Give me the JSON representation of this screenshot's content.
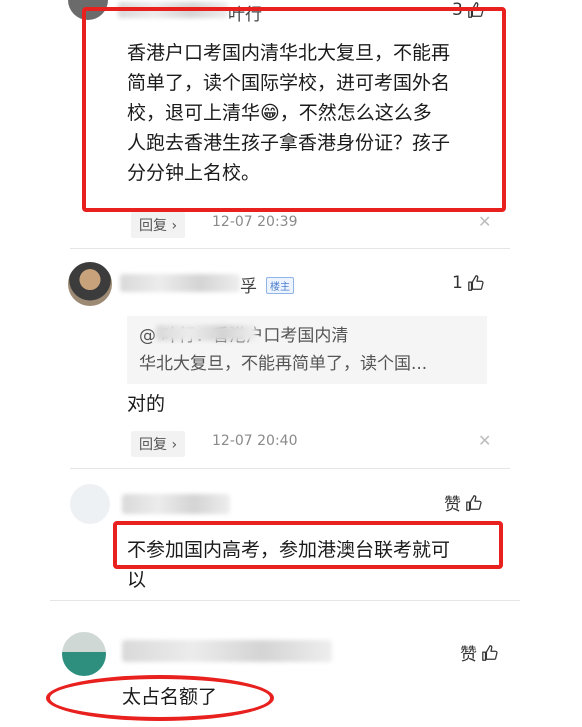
{
  "comments": [
    {
      "author_fragment": "叶行",
      "likes": "3",
      "text": "香港户口考国内清华北大复旦，不能再简单了，读个国际学校，进可考国外名校，退可上清华😁，不然怎么这么多人跑去香港生孩子拿香港身份证？孩子分分钟上名校。",
      "lines": [
        "香港户口考国内清华北大复旦，不能再",
        "简单了，读个国际学校，进可考国外名",
        "校，退可上清华😁，不然怎么这么多",
        "人跑去香港生孩子拿香港身份证？孩子",
        "分分钟上名校。"
      ],
      "reply_label": "回复 ›",
      "time": "12-07 20:39"
    },
    {
      "author_fragment": "孚",
      "badge": "楼主",
      "likes": "1",
      "quote_lines": [
        "@              叶行：香港户口考国内清",
        "华北大复旦，不能再简单了，读个国..."
      ],
      "text": "对的",
      "reply_label": "回复 ›",
      "time": "12-07 20:40"
    },
    {
      "likes_label": "赞",
      "lines": [
        "不参加国内高考，参加港澳台联考就可",
        "以"
      ]
    },
    {
      "likes_label": "赞",
      "text": "太占名额了"
    }
  ],
  "icons": {
    "thumb": "thumbs-up-icon",
    "close": "close-icon"
  },
  "colors": {
    "highlight": "#e8201e",
    "badge": "#4a7fd0"
  }
}
